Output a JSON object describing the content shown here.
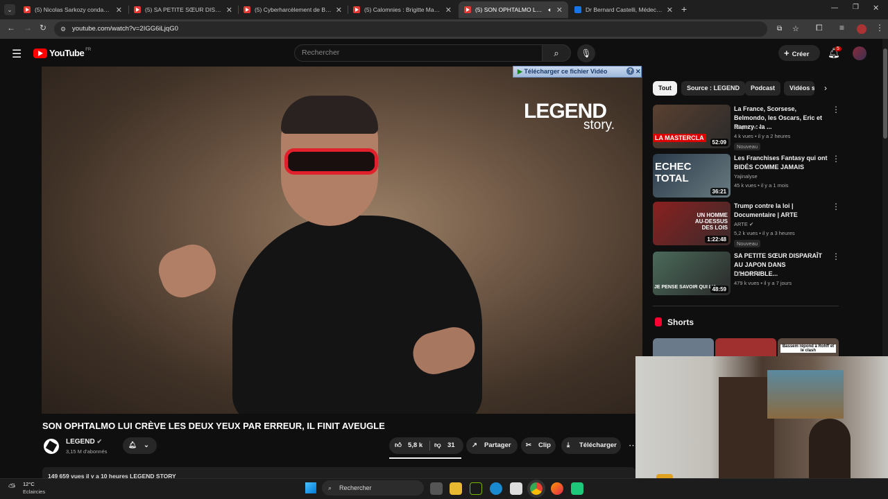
{
  "browser": {
    "tabs": [
      {
        "title": "(5) Nicolas Sarkozy condamné",
        "favicon": "youtube"
      },
      {
        "title": "(5) SA PETITE SŒUR DISPARAÎT",
        "favicon": "youtube"
      },
      {
        "title": "(5) Cyberharcèlement de Brigitte",
        "favicon": "youtube"
      },
      {
        "title": "(5) Calomnies : Brigitte Macron",
        "favicon": "youtube"
      },
      {
        "title": "(5) SON OPHTALMO LUI CR",
        "favicon": "youtube",
        "active": true
      },
      {
        "title": "Dr Bernard Castelli, Médecin gé",
        "favicon": "doctolib"
      }
    ],
    "url": "youtube.com/watch?v=2IGG6iLjqG0"
  },
  "youtube": {
    "logo": "YouTube",
    "region": "FR",
    "search_placeholder": "Rechercher",
    "create_label": "Créer",
    "notif_count": "5",
    "download_banner": "Télécharger ce fichier Vidéo",
    "download_banner_help": "?",
    "video": {
      "brand_big": "LEGEND",
      "brand_small": "story.",
      "title": "SON OPHTALMO LUI CRÈVE LES DEUX YEUX PAR ERREUR, IL FINIT AVEUGLE",
      "channel": "LEGEND",
      "subscribers": "3,15 M d'abonnés",
      "likes": "5,8 k",
      "dislikes": "31",
      "share": "Partager",
      "clip": "Clip",
      "download": "Télécharger",
      "views_line": "149 659 vues  il y a 10 heures  LEGEND STORY"
    },
    "chips": [
      "Tout",
      "Source : LEGEND",
      "Podcast",
      "Vidéos s"
    ],
    "recommendations": [
      {
        "title": "La France, Scorsese, Belmondo, les Oscars, Eric et Ramzy : la ...",
        "channel": "Clique TV",
        "meta": "4 k vues • il y a 2 heures",
        "badge": "Nouveau",
        "duration": "52:09",
        "thumb_text": "LA MASTERCLA"
      },
      {
        "title": "Les Franchises Fantasy qui ont BIDÉS COMME JAMAIS",
        "channel": "Yajinalyse",
        "meta": "45 k vues • il y a 1 mois",
        "badge": "",
        "duration": "36:21",
        "thumb_text": "ECHEC TOTAL"
      },
      {
        "title": "Trump contre la loi | Documentaire | ARTE",
        "channel": "ARTE",
        "meta": "5,2 k vues • il y a 3 heures",
        "badge": "Nouveau",
        "duration": "1:22:48",
        "thumb_text": "UN HOMME AU-DESSUS DES LOIS"
      },
      {
        "title": "SA PETITE SŒUR DISPARAÎT AU JAPON DANS D'HORRIBLE...",
        "channel": "LEGEND",
        "meta": "479 k vues • il y a 7 jours",
        "badge": "",
        "duration": "48:59",
        "thumb_text": "JE PENSE SAVOIR QUI L'A"
      }
    ],
    "shorts_title": "Shorts",
    "short_caption": "Bassem répond à Rohff et le clash"
  },
  "taskbar": {
    "weather_temp": "12°C",
    "weather_desc": "Eclaircies",
    "search": "Rechercher"
  },
  "colors": {
    "yt_red": "#ff0000",
    "bg": "#0f0f0f",
    "accent_red_glasses": "#e0202a"
  }
}
